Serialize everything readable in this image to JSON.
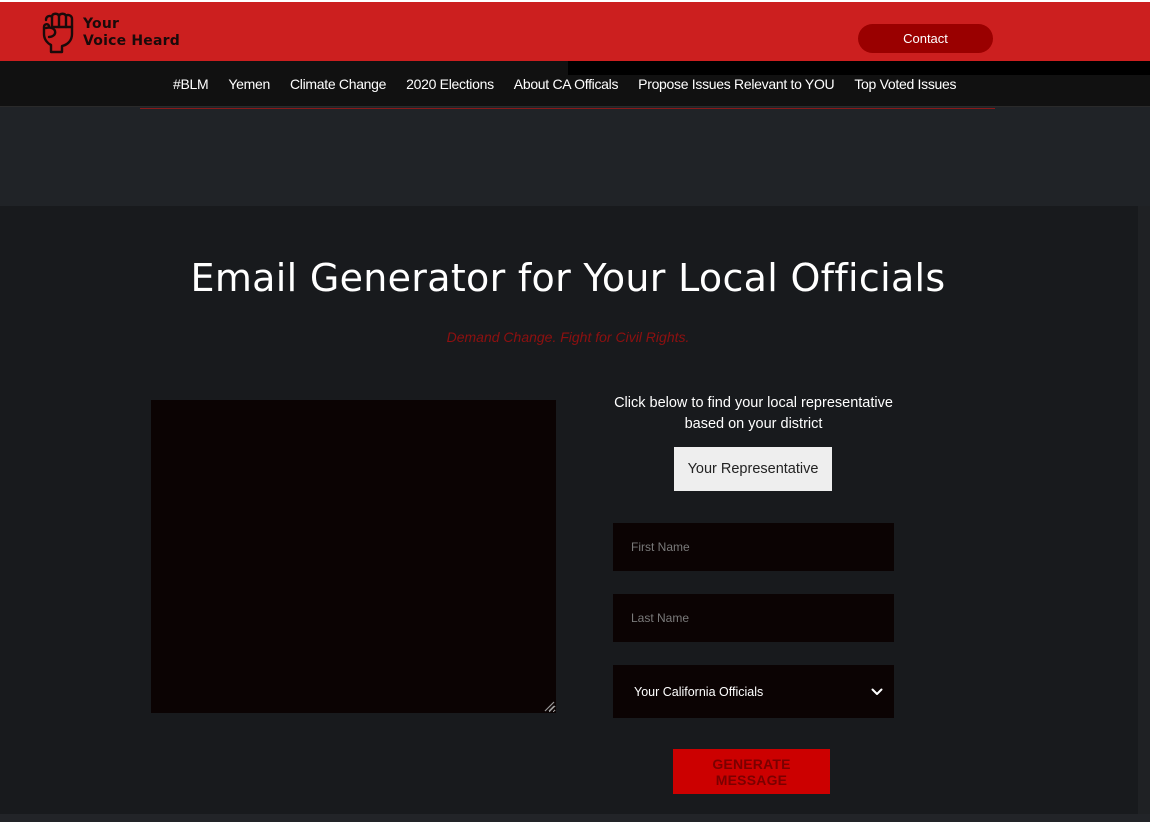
{
  "header": {
    "logo_line1": "Your",
    "logo_line2": "Voice Heard",
    "contact_label": "Contact"
  },
  "nav": {
    "items": [
      {
        "label": "#BLM"
      },
      {
        "label": "Yemen"
      },
      {
        "label": "Climate Change"
      },
      {
        "label": "2020 Elections"
      },
      {
        "label": "About CA Officals"
      },
      {
        "label": "Propose Issues Relevant to YOU"
      },
      {
        "label": "Top Voted Issues"
      }
    ]
  },
  "main": {
    "title": "Email Generator for Your Local Officials",
    "subtitle": "Demand Change. Fight for Civil Rights.",
    "message_value": "",
    "instructions": "Click below to find your local representative based on your district",
    "rep_button_label": "Your Representative",
    "first_name": {
      "value": "",
      "placeholder": "First Name"
    },
    "last_name": {
      "value": "",
      "placeholder": "Last Name"
    },
    "officials_select": {
      "selected": "Your California Officials"
    },
    "generate_label": "GENERATE MESSAGE"
  },
  "icons": {
    "logo": "raised-fist-icon",
    "select_arrow": "chevron-down-icon",
    "textarea_grip": "resize-grip-icon"
  },
  "colors": {
    "brand_red": "#cc1f1f",
    "contact_red": "#9a0000",
    "nav_bg": "#111111",
    "band_bg": "#202327",
    "main_bg": "#181a1d",
    "field_bg": "#0b0303",
    "subtitle_red": "#8e1010",
    "generate_red": "#cc0000",
    "generate_text": "#7a0000"
  }
}
